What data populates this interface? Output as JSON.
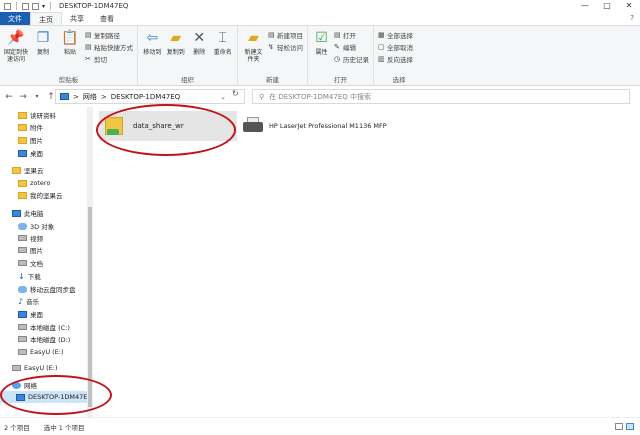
{
  "window": {
    "title": "DESKTOP-1DM47EQ",
    "minimize": "—",
    "maximize": "□",
    "close": "✕"
  },
  "ribbon_tabs": [
    {
      "label": "文件"
    },
    {
      "label": "主页"
    },
    {
      "label": "共享"
    },
    {
      "label": "查看"
    }
  ],
  "ribbon_help": "?",
  "ribbon": {
    "clipboard": {
      "label": "剪贴板",
      "pin": "固定到快速访问",
      "copy": "复制",
      "paste": "粘贴",
      "copy_path": "复制路径",
      "paste_shortcut": "粘贴快捷方式",
      "cut": "剪切"
    },
    "organize": {
      "label": "组织",
      "move_to": "移动到",
      "copy_to": "复制到",
      "delete": "删除",
      "rename": "重命名"
    },
    "new": {
      "label": "新建",
      "new_folder": "新建文件夹",
      "new_item": "新建项目",
      "easy_access": "轻松访问"
    },
    "open": {
      "label": "打开",
      "properties": "属性",
      "open": "打开",
      "edit": "编辑",
      "history": "历史记录"
    },
    "select": {
      "label": "选择",
      "select_all": "全部选择",
      "select_none": "全部取消",
      "invert": "反向选择"
    }
  },
  "address": {
    "path": [
      "网络",
      "DESKTOP-1DM47EQ"
    ],
    "separator": ">",
    "search_placeholder": "在 DESKTOP-1DM47EQ 中搜索"
  },
  "sidebar": {
    "items": [
      {
        "label": "读研资料",
        "icon": "folder-icon"
      },
      {
        "label": "附件",
        "icon": "folder-icon"
      },
      {
        "label": "图片",
        "icon": "folder-icon"
      },
      {
        "label": "桌面",
        "icon": "desktop-icon"
      },
      {
        "label": "坚果云",
        "icon": "cloud-icon"
      },
      {
        "label": "zotero",
        "icon": "folder-icon"
      },
      {
        "label": "我的坚果云",
        "icon": "folder-icon"
      },
      {
        "label": "此电脑",
        "icon": "pc-icon"
      },
      {
        "label": "3D 对象",
        "icon": "3d-icon"
      },
      {
        "label": "视频",
        "icon": "video-icon"
      },
      {
        "label": "图片",
        "icon": "pictures-icon"
      },
      {
        "label": "文档",
        "icon": "documents-icon"
      },
      {
        "label": "下载",
        "icon": "download-icon"
      },
      {
        "label": "移动云盘同步盘",
        "icon": "cloud-drive-icon"
      },
      {
        "label": "音乐",
        "icon": "music-icon"
      },
      {
        "label": "桌面",
        "icon": "desktop-icon"
      },
      {
        "label": "本地磁盘 (C:)",
        "icon": "drive-icon"
      },
      {
        "label": "本地磁盘 (D:)",
        "icon": "drive-icon"
      },
      {
        "label": "EasyU (E:)",
        "icon": "drive-icon"
      },
      {
        "label": "EasyU (E:)",
        "icon": "drive-icon"
      },
      {
        "label": "网络",
        "icon": "network-icon"
      },
      {
        "label": "DESKTOP-1DM47E",
        "icon": "computer-icon"
      }
    ]
  },
  "content": {
    "items": [
      {
        "label": "data_share_wr",
        "icon": "shared-folder-icon"
      },
      {
        "label": "HP LaserJet Professional M1136 MFP",
        "icon": "printer-icon"
      }
    ]
  },
  "status": {
    "count": "2 个项目",
    "selected": "选中 1 个项目"
  },
  "colors": {
    "accent": "#1a5fb4",
    "selection": "#cce4f7",
    "annotation": "#c0141c"
  }
}
